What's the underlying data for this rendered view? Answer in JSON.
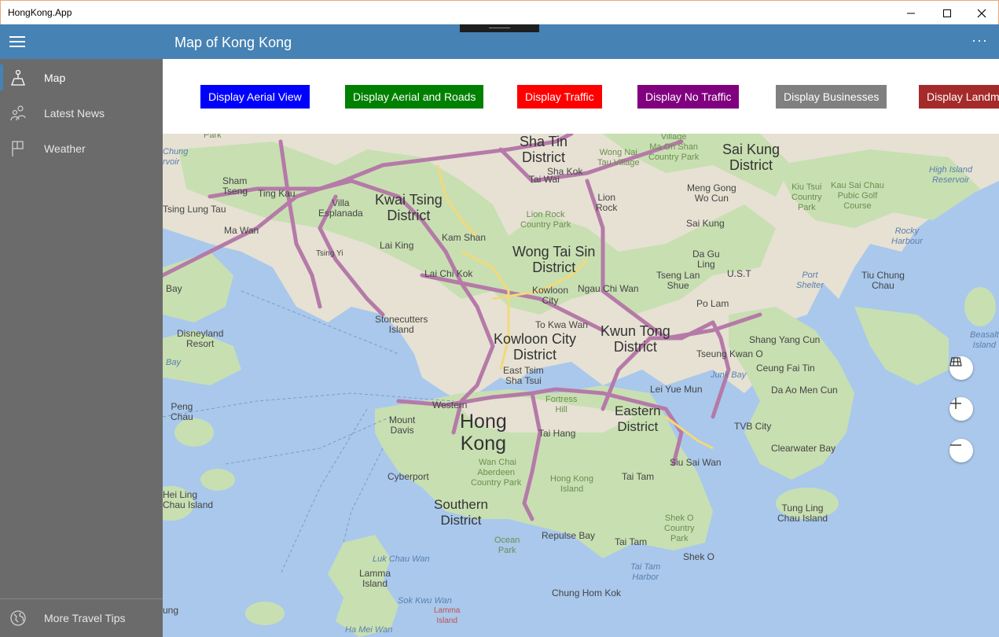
{
  "window": {
    "title": "HongKong.App"
  },
  "appbar": {
    "title": "Map of Kong Kong"
  },
  "sidebar": {
    "items": [
      {
        "label": "Map",
        "icon": "map-icon"
      },
      {
        "label": "Latest News",
        "icon": "people-icon"
      },
      {
        "label": "Weather",
        "icon": "flag-icon"
      }
    ],
    "footer": {
      "label": "More Travel Tips",
      "icon": "globe-icon"
    }
  },
  "buttons": [
    {
      "label": "Display Aerial View",
      "color": "#0000ff"
    },
    {
      "label": "Display Aerial and Roads",
      "color": "#008000"
    },
    {
      "label": "Display Traffic",
      "color": "#ff0000"
    },
    {
      "label": "Display No Traffic",
      "color": "#800080"
    },
    {
      "label": "Display Businesses",
      "color": "#808080"
    },
    {
      "label": "Display Landm",
      "color": "#a52a2a"
    }
  ],
  "map": {
    "labels": {
      "sha_tin": "Sha Tin\nDistrict",
      "sai_kung": "Sai Kung\nDistrict",
      "kwai_tsing": "Kwai Tsing\nDistrict",
      "wong_tai_sin": "Wong Tai Sin\nDistrict",
      "kowloon_city": "Kowloon City\nDistrict",
      "kwun_tong": "Kwun Tong\nDistrict",
      "hong_kong": "Hong\nKong",
      "eastern": "Eastern\nDistrict",
      "southern": "Southern\nDistrict",
      "sham_tseng": "Sham\nTseng",
      "ting_kau": "Ting Kau",
      "tsing_lung_tau": "Tsing Lung Tau",
      "ma_wan": "Ma Wan",
      "villa_esplanada": "Villa\nEsplanada",
      "kam_shan": "Kam Shan",
      "lai_king": "Lai King",
      "tsing_yi": "Tsing Yi",
      "lai_chi_kok": "Lai Chi Kok",
      "kowloon_city_small": "Kowloon\nCity",
      "ngau_chi_wan": "Ngau Chi Wan",
      "tseng_lan_shue": "Tseng Lan\nShue",
      "po_lam": "Po Lam",
      "stonecutters": "Stonecutters\nIsland",
      "disneyland": "Disneyland\nResort",
      "to_kwa_wan": "To Kwa Wan",
      "east_tsim_sha_tsui": "East Tsim\nSha Tsui",
      "fortress_hill": "Fortress\nHill",
      "western": "Western",
      "mount_davis": "Mount\nDavis",
      "tai_hang": "Tai Hang",
      "wan_chai": "Wan Chai",
      "aberdeen": "Aberdeen\nCountry Park",
      "cyberport": "Cyberport",
      "hong_kong_island": "Hong Kong\nIsland",
      "tai_tam": "Tai Tam",
      "siu_sai_wan": "Siu Sai Wan",
      "tvb_city": "TVB City",
      "clearwater_bay": "Clearwater Bay",
      "tseung_kwan_o": "Tseung Kwan O",
      "lei_yue_mun": "Lei Yue Mun",
      "shang_yang_cun": "Shang Yang Cun",
      "ceung_fai_tin": "Ceung Fai Tin",
      "da_ao_men_cun": "Da Ao Men Cun",
      "peng_chau": "Peng\nChau",
      "hei_ling_chau": "Hei Ling\nChau Island",
      "lamma": "Lamma\nIsland",
      "repulse_bay": "Repulse Bay",
      "chung_hom_kok": "Chung Hom Kok",
      "tai_tam_harbor": "Tai Tam\nHarbor",
      "shek_o": "Shek O",
      "shek_o_park": "Shek O\nCountry\nPark",
      "tung_ling": "Tung Ling\nChau Island",
      "tai_wai": "Tai Wai",
      "sha_kok": "Sha Kok",
      "lion_rock": "Lion Rock\nCountry Park",
      "lion_rock_peak": "Lion\nRock",
      "wong_nai_tau": "Wong Nai\nTau Village",
      "ma_on_shan": "Village\nMa On Shan\nCountry Park",
      "meng_gong_wo_cun": "Meng Gong\nWo Cun",
      "sai_kung_town": "Sai Kung",
      "da_gu_ling": "Da Gu\nLing",
      "ust": "U.S.T",
      "port_shelter": "Port\nShelter",
      "tiu_chung_chau": "Tiu Chung\nChau",
      "rocky_harbour": "Rocky\nHarbour",
      "high_island": "High Island\nReservoir",
      "kiu_tsui": "Kiu Tsui\nCountry\nPark",
      "kau_sai_chau": "Kau Sai Chau\nPubic Golf\nCourse",
      "junk_bay": "Junk Bay",
      "beasalt": "Beasalt\nIsland",
      "chung_reservoir": "Chung\nrvoir",
      "park_top": "Park",
      "bay_left": "Bay",
      "bay_left2": "Bay",
      "ocean_park": "Ocean\nPark",
      "lamma_island2": "Lamma\nIsland",
      "luk_chau_wan": "Luk Chau Wan",
      "sok_kwu_wan": "Sok Kwu Wan",
      "ha_mei_wan": "Ha Mei Wan",
      "ung": "ung"
    }
  }
}
